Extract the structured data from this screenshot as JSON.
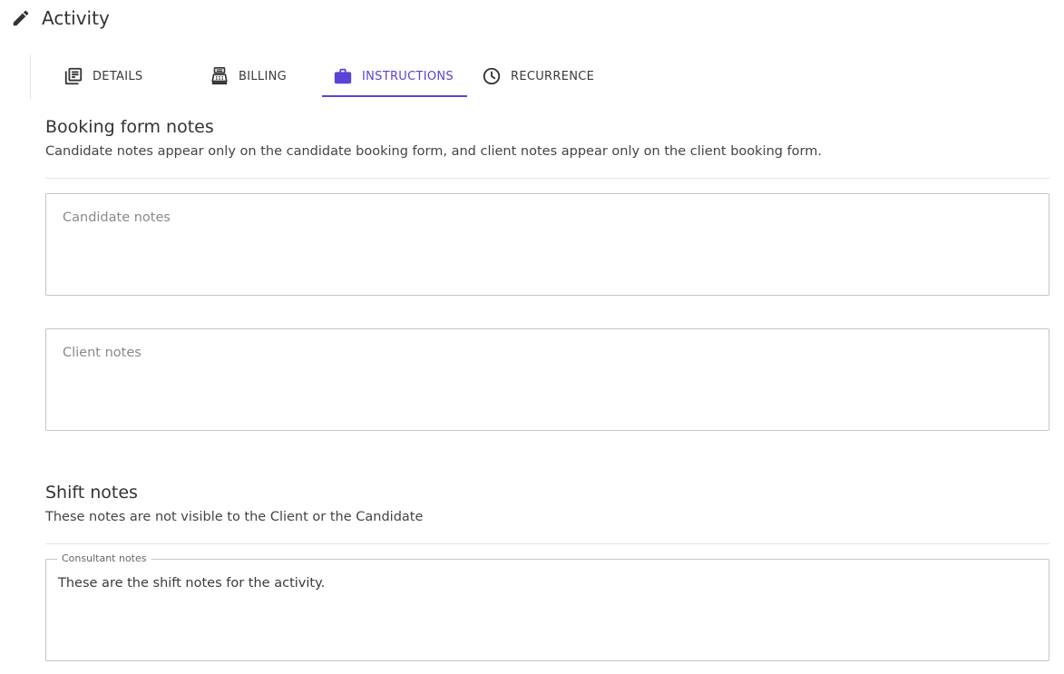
{
  "header": {
    "title": "Activity",
    "icon": "pencil-icon"
  },
  "tabs": [
    {
      "label": "DETAILS",
      "icon": "document-list-icon",
      "active": false
    },
    {
      "label": "BILLING",
      "icon": "cash-register-icon",
      "active": false
    },
    {
      "label": "INSTRUCTIONS",
      "icon": "briefcase-icon",
      "active": true
    },
    {
      "label": "RECURRENCE",
      "icon": "clock-icon",
      "active": false
    }
  ],
  "booking": {
    "title": "Booking form notes",
    "description": "Candidate notes appear only on the candidate booking form, and client notes appear only on the client booking form.",
    "candidate_placeholder": "Candidate notes",
    "client_placeholder": "Client notes"
  },
  "shift": {
    "title": "Shift notes",
    "description": "These notes are not visible to the Client or the Candidate",
    "consultant_label": "Consultant notes",
    "consultant_value": "These are the shift notes for the activity."
  },
  "colors": {
    "accent": "#5b43d6",
    "text": "#333333",
    "border": "#c4c4c4"
  }
}
